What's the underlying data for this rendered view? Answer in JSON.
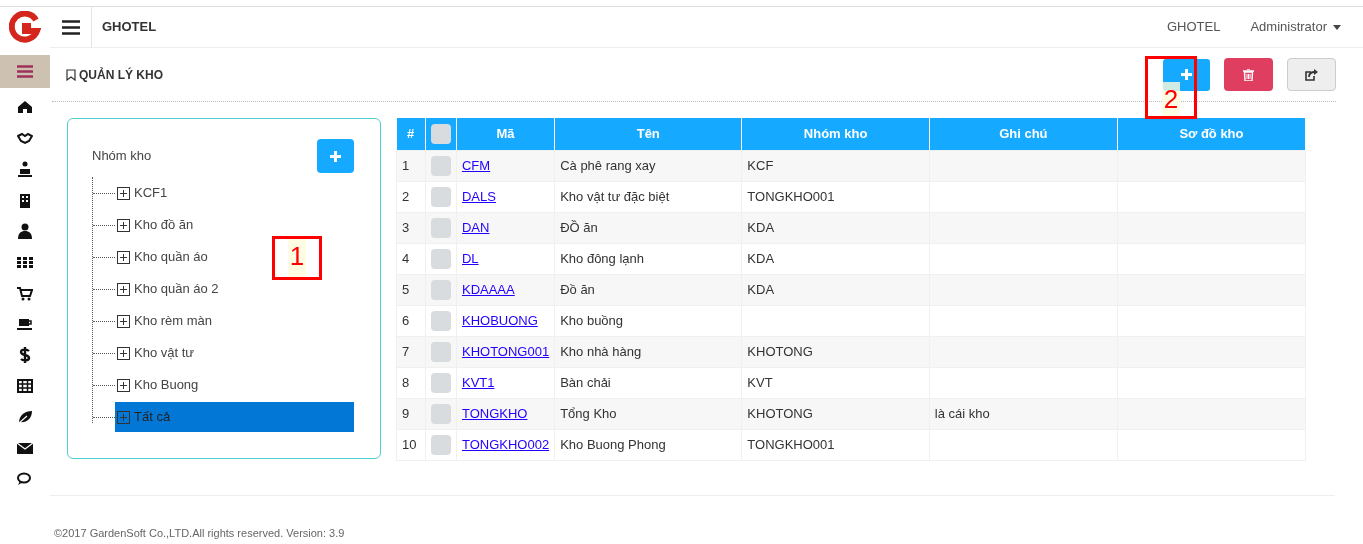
{
  "header": {
    "app_name": "GHOTEL",
    "hotel": "GHOTEL",
    "user": "Administrator"
  },
  "page_title": "QUẢN LÝ KHO",
  "tree": {
    "title": "Nhóm kho",
    "items": [
      {
        "label": "KCF1",
        "selected": false
      },
      {
        "label": "Kho đồ ăn",
        "selected": false
      },
      {
        "label": "Kho quần áo",
        "selected": false
      },
      {
        "label": "Kho quần áo 2",
        "selected": false
      },
      {
        "label": "Kho rèm màn",
        "selected": false
      },
      {
        "label": "Kho vật tư",
        "selected": false
      },
      {
        "label": "Kho Buong",
        "selected": false
      },
      {
        "label": "Tất cả",
        "selected": true
      }
    ]
  },
  "table": {
    "columns": [
      "#",
      "Mã",
      "Tên",
      "Nhóm kho",
      "Ghi chú",
      "Sơ đồ kho"
    ],
    "header_checked": false,
    "rows": [
      {
        "no": "1",
        "checked": false,
        "code": "CFM",
        "name": "Cà phê rang xay",
        "group": "KCF"
      },
      {
        "no": "2",
        "checked": false,
        "code": "DALS",
        "name": "Kho vật tư đặc biệt",
        "group": "TONGKHO001"
      },
      {
        "no": "3",
        "checked": false,
        "code": "DAN",
        "name": "ĐỒ ăn",
        "group": "KDA"
      },
      {
        "no": "4",
        "checked": false,
        "code": "DL",
        "name": "Kho đông lạnh",
        "group": "KDA"
      },
      {
        "no": "5",
        "checked": false,
        "code": "KDAAAA",
        "name": "Đồ ăn",
        "group": "KDA"
      },
      {
        "no": "6",
        "checked": false,
        "code": "KHOBUONG",
        "name": "Kho buồng"
      },
      {
        "no": "7",
        "checked": false,
        "code": "KHOTONG001",
        "name": "Kho nhà hàng",
        "group": "KHOTONG"
      },
      {
        "no": "8",
        "checked": false,
        "code": "KVT1",
        "name": "Bàn chải",
        "group": "KVT"
      },
      {
        "no": "9",
        "checked": false,
        "code": "TONGKHO",
        "name": "Tổng Kho",
        "group": "KHOTONG",
        "note": "là cái kho"
      },
      {
        "no": "10",
        "checked": false,
        "code": "TONGKHO002",
        "name": "Kho Buong Phong",
        "group": "TONGKHO001"
      }
    ]
  },
  "annotations": [
    {
      "label": "1"
    },
    {
      "label": "2"
    }
  ],
  "footer": "©2017 GardenSoft Co.,LTD.All rights reserved. Version: 3.9"
}
